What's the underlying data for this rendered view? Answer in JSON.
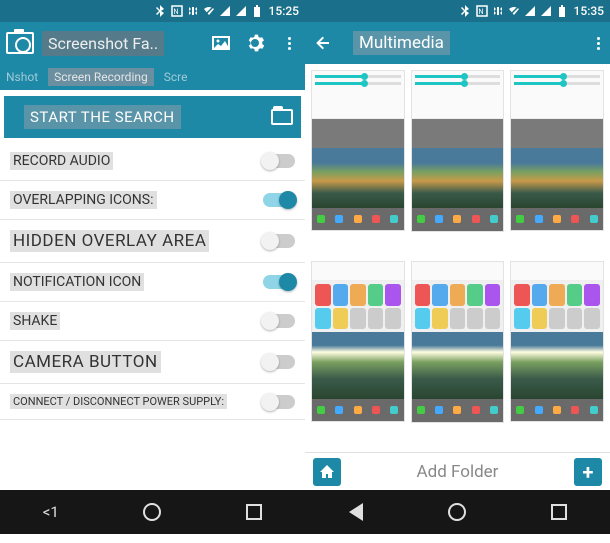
{
  "colors": {
    "primary": "#1e88a7",
    "primaryDark": "#1a6f8a",
    "accentToggle": "#1fc5c3"
  },
  "statusLeft": {
    "time": "15:25",
    "icons": [
      "bluetooth",
      "nfc",
      "vibrate",
      "wifi-off",
      "signal",
      "signal",
      "battery"
    ]
  },
  "statusRight": {
    "time": "15:35",
    "icons": [
      "bluetooth",
      "nfc",
      "vibrate",
      "wifi-off",
      "signal",
      "signal",
      "battery"
    ]
  },
  "left": {
    "appTitle": "Screenshot Fa..",
    "actionIcons": [
      "image-icon",
      "gear-icon",
      "more-icon"
    ],
    "tabs": {
      "prefix": "Nshot",
      "center": "Screen Recording",
      "suffix": "Scre"
    },
    "searchLabel": "START THE SEARCH",
    "rows": [
      {
        "label": "RECORD AUDIO",
        "on": false,
        "big": false
      },
      {
        "label": "OVERLAPPING ICONS:",
        "on": true,
        "big": false
      },
      {
        "label": "HIDDEN OVERLAY AREA",
        "on": false,
        "big": true
      },
      {
        "label": "NOTIFICATION ICON",
        "on": true,
        "big": false
      },
      {
        "label": "SHAKE",
        "on": false,
        "big": false
      },
      {
        "label": "CAMERA BUTTON",
        "on": false,
        "big": true
      },
      {
        "label": "CONNECT / DISCONNECT POWER SUPPLY:",
        "on": false,
        "big": false
      }
    ]
  },
  "right": {
    "title": "Multimedia",
    "thumbnails": [
      {
        "variant": 1
      },
      {
        "variant": 1
      },
      {
        "variant": 1
      },
      {
        "variant": 2
      },
      {
        "variant": 2
      },
      {
        "variant": 2
      }
    ],
    "bottom": {
      "addFolder": "Add Folder"
    }
  },
  "navLeftBackText": "<1"
}
